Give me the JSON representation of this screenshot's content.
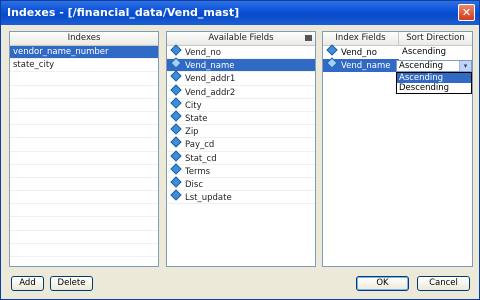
{
  "window": {
    "title": "Indexes - [/financial_data/Vend_mast]",
    "close_glyph": "✕"
  },
  "indexes": {
    "header": "Indexes",
    "items": [
      "vendor_name_number",
      "state_city"
    ],
    "selected": 0
  },
  "available": {
    "header": "Available Fields",
    "items": [
      "Vend_no",
      "Vend_name",
      "Vend_addr1",
      "Vend_addr2",
      "City",
      "State",
      "Zip",
      "Pay_cd",
      "Stat_cd",
      "Terms",
      "Disc",
      "Lst_update"
    ],
    "selected": 1
  },
  "index_fields": {
    "headers": [
      "Index Fields",
      "Sort Direction"
    ],
    "rows": [
      {
        "field": "Vend_no",
        "direction": "Ascending"
      },
      {
        "field": "Vend_name",
        "direction": "Ascending"
      }
    ],
    "selected_row": 1
  },
  "dropdown": {
    "options": [
      "Ascending",
      "Descending"
    ],
    "selected": 0,
    "arrow_glyph": "▾"
  },
  "buttons": {
    "add": "Add",
    "delete": "Delete",
    "ok": "OK",
    "cancel": "Cancel"
  }
}
